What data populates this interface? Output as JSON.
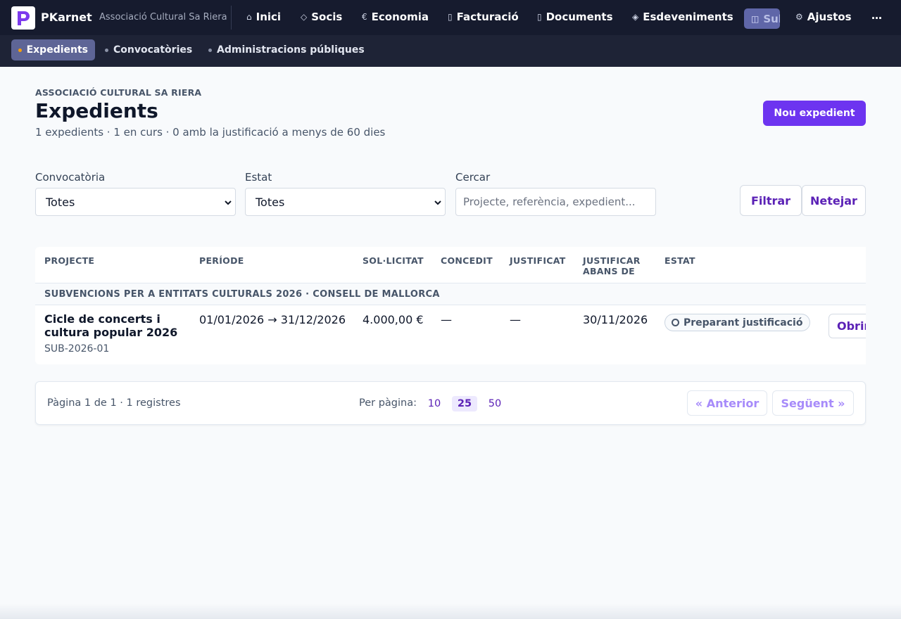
{
  "app": {
    "brand": "PKarnet",
    "org": "Associació Cultural Sa Riera"
  },
  "nav": {
    "items": [
      {
        "icon": "⌂",
        "label": "Inici"
      },
      {
        "icon": "◇",
        "label": "Socis"
      },
      {
        "icon": "€",
        "label": "Economia"
      },
      {
        "icon": "▯",
        "label": "Facturació"
      },
      {
        "icon": "▯",
        "label": "Documents"
      },
      {
        "icon": "◈",
        "label": "Esdeveniments"
      },
      {
        "icon": "◫",
        "label": "Subvencions"
      },
      {
        "icon": "⚙",
        "label": "Ajustos"
      }
    ],
    "more": "…"
  },
  "subnav": {
    "tabs": [
      {
        "label": "Expedients"
      },
      {
        "label": "Convocatòries"
      },
      {
        "label": "Administracions públiques"
      }
    ]
  },
  "header": {
    "eyebrow": "ASSOCIACIÓ CULTURAL SA RIERA",
    "title": "Expedients",
    "summary": "1 expedients · 1 en curs · 0 amb la justificació a menys de 60 dies",
    "new_button": "Nou expedient"
  },
  "filters": {
    "convocatoria": {
      "label": "Convocatòria",
      "value": "Totes"
    },
    "estat": {
      "label": "Estat",
      "value": "Totes"
    },
    "search": {
      "label": "Cercar",
      "placeholder": "Projecte, referència, expedient..."
    },
    "filter_button": "Filtrar",
    "clear_button": "Netejar"
  },
  "table": {
    "columns": {
      "projecte": "PROJECTE",
      "periode": "PERÍODE",
      "sollicitat": "SOL·LICITAT",
      "concedit": "CONCEDIT",
      "justificat": "JUSTIFICAT",
      "justificar": "JUSTIFICAR ABANS DE",
      "estat": "ESTAT"
    },
    "group": "SUBVENCIONS PER A ENTITATS CULTURALS 2026 · CONSELL DE MALLORCA",
    "rows": [
      {
        "project": "Cicle de concerts i cultura popular 2026",
        "ref": "SUB-2026-01",
        "period": "01/01/2026 → 31/12/2026",
        "requested": "4.000,00 €",
        "granted": "—",
        "justified": "—",
        "deadline": "30/11/2026",
        "status": "Preparant justificació",
        "action": "Obrir"
      }
    ]
  },
  "pagination": {
    "info": "Pàgina 1 de 1 · 1 registres",
    "per_page_label": "Per pàgina:",
    "per_page_options": [
      "10",
      "25",
      "50"
    ],
    "selected_per_page": "25",
    "prev": "« Anterior",
    "next": "Següent »"
  },
  "colors": {
    "topbar": "#161b2e",
    "accent": "#6d34f0",
    "link": "#5b21b6"
  }
}
